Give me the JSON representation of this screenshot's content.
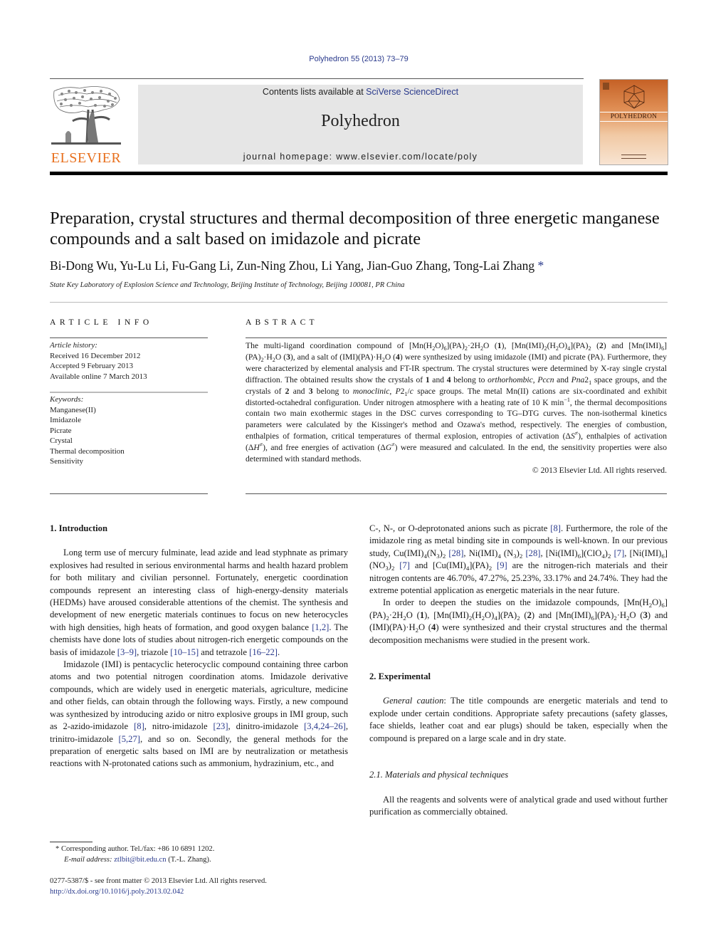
{
  "header": {
    "citation": "Polyhedron 55 (2013) 73–79",
    "contents_prefix": "Contents lists available at ",
    "contents_link": "SciVerse ScienceDirect",
    "journal_name": "Polyhedron",
    "homepage_label": "journal homepage: ",
    "homepage_url": "www.elsevier.com/locate/poly",
    "publisher_logo_text": "ELSEVIER",
    "cover_title": "POLYHEDRON",
    "colors": {
      "link": "#2a3a8c",
      "elsevier_orange": "#e8701e",
      "band_gray": "#e6e6e6",
      "cover_orange": "#c56126"
    }
  },
  "article": {
    "title": "Preparation, crystal structures and thermal decomposition of three energetic manganese compounds and a salt based on imidazole and picrate",
    "authors": "Bi-Dong Wu, Yu-Lu Li, Fu-Gang Li, Zun-Ning Zhou, Li Yang, Jian-Guo Zhang, Tong-Lai Zhang",
    "corresponding_marker": "*",
    "affiliation": "State Key Laboratory of Explosion Science and Technology, Beijing Institute of Technology, Beijing 100081, PR China"
  },
  "article_info": {
    "heading": "ARTICLE INFO",
    "history_label": "Article history:",
    "history": [
      "Received 16 December 2012",
      "Accepted 9 February 2013",
      "Available online 7 March 2013"
    ],
    "keywords_label": "Keywords:",
    "keywords": [
      "Manganese(II)",
      "Imidazole",
      "Picrate",
      "Crystal",
      "Thermal decomposition",
      "Sensitivity"
    ]
  },
  "abstract": {
    "heading": "ABSTRACT",
    "copyright": "© 2013 Elsevier Ltd. All rights reserved."
  },
  "body": {
    "sec1_heading": "1. Introduction",
    "sec2_heading": "2. Experimental",
    "sec2_caution_label": "General caution",
    "sec2_caution_text": ": The title compounds are energetic materials and tend to explode under certain conditions. Appropriate safety precautions (safety glasses, face shields, leather coat and ear plugs) should be taken, especially when the compound is prepared on a large scale and in dry state.",
    "sec21_heading": "2.1. Materials and physical techniques",
    "sec21_text": "All the reagents and solvents were of analytical grade and used without further purification as commercially obtained."
  },
  "footnotes": {
    "marker": "*",
    "corresponding": "Corresponding author. Tel./fax: +86 10 6891 1202.",
    "email_label": "E-mail address:",
    "email": "ztlbit@bit.edu.cn",
    "email_suffix": " (T.-L. Zhang).",
    "issn_line": "0277-5387/$ - see front matter © 2013 Elsevier Ltd. All rights reserved.",
    "doi": "http://dx.doi.org/10.1016/j.poly.2013.02.042"
  }
}
